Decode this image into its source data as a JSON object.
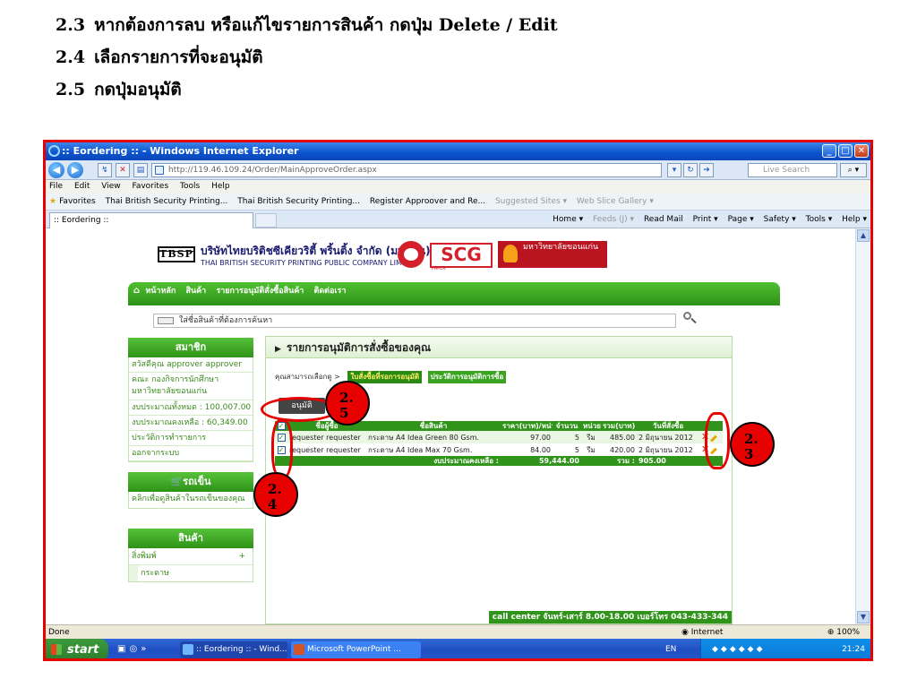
{
  "steps": [
    {
      "num": "2.3",
      "text": "หากต้องการลบ หรือแก้ไขรายการสินค้า กดปุ่ม Delete / Edit"
    },
    {
      "num": "2.4",
      "text": "เลือกรายการที่จะอนุมัติ"
    },
    {
      "num": "2.5",
      "text": "กดปุ่มอนุมัติ"
    }
  ],
  "browser": {
    "title": ":: Eordering :: - Windows Internet Explorer",
    "url": "http://119.46.109.24/Order/MainApproveOrder.aspx",
    "search_placeholder": "Live Search",
    "menu": [
      "File",
      "Edit",
      "View",
      "Favorites",
      "Tools",
      "Help"
    ],
    "favorites_label": "Favorites",
    "favorites": [
      "Thai British Security Printing...",
      "Thai British Security Printing...",
      "Register Approover and Re...",
      "Suggested Sites ▾",
      "Web Slice Gallery ▾"
    ],
    "tab_label": ":: Eordering ::",
    "commands": [
      "Home ▾",
      "Feeds (J) ▾",
      "Read Mail",
      "Print ▾",
      "Page ▾",
      "Safety ▾",
      "Tools ▾",
      "Help ▾"
    ],
    "status": "Done",
    "zone": "Internet",
    "zoom": "100%"
  },
  "site": {
    "logo_short": "TBSP",
    "company_th": "บริษัทไทยบริติชซีเคียวริตี้ พริ้นติ้ง จำกัด (มหาชน)",
    "company_en": "THAI BRITISH SECURITY PRINTING PUBLIC COMPANY LIMITED",
    "scg": "SCG",
    "scg_sub": "PAPER",
    "univ": "มหาวิทยาลัยขอนแก่น",
    "nav": [
      "หน้าหลัก",
      "สินค้า",
      "รายการอนุมัติสั่งซื้อสินค้า",
      "ติดต่อเรา"
    ],
    "search_placeholder": "ใส่ชื่อสินค้าที่ต้องการค้นหา"
  },
  "sidebar": {
    "members_title": "สมาชิก",
    "members": [
      "สวัสดีคุณ approver approver",
      "คณะ กองกิจการนักศึกษา มหาวิทยาลัยขอนแก่น",
      "งบประมาณทั้งหมด : 100,007.00",
      "งบประมาณคงเหลือ : 60,349.00",
      "ประวัติการทำรายการ",
      "ออกจากระบบ"
    ],
    "cart_title": "รถเข็น",
    "cart_link": "คลิกเพื่อดูสินค้าในรถเข็นของคุณ",
    "products_title": "สินค้า",
    "products_row": "สิ่งพิมพ์",
    "products_plus": "+",
    "products_sub": "กระดาษ"
  },
  "main": {
    "title": "รายการอนุมัติการสั่งซื้อของคุณ",
    "crumb_label": "คุณสามารถเลือกดู >",
    "tab_pending": "ใบสั่งซื้อที่รอการอนุมัติ",
    "tab_history": "ประวัติการอนุมัติการซื้อ",
    "approve_button": "อนุมัติ",
    "columns": [
      "",
      "ชื่อผู้ซื้อ",
      "ชื่อสินค้า",
      "ราคา(บาท)/หน่วย",
      "จำนวน",
      "หน่วย",
      "รวม(บาท)",
      "วันที่สั่งซื้อ",
      ""
    ],
    "rows": [
      {
        "checked": "✓",
        "buyer": "requester requester",
        "product": "กระดาษ A4 Idea Green 80 Gsm.",
        "price": "97.00",
        "qty": "5",
        "unit": "รีม",
        "total": "485.00",
        "date": "2 มิถุนายน 2012"
      },
      {
        "checked": "✓",
        "buyer": "requester requester",
        "product": "กระดาษ A4 Idea Max 70 Gsm.",
        "price": "84.00",
        "qty": "5",
        "unit": "รีม",
        "total": "420.00",
        "date": "2 มิถุนายน 2012"
      }
    ],
    "header_check": "✓",
    "budget_label": "งบประมาณคงเหลือ :",
    "budget_value": "59,444.00",
    "sum_label": "รวม :",
    "sum_value": "905.00",
    "callcenter": "call center จันทร์-เสาร์ 8.00-18.00 เบอร์โทร 043-433-344"
  },
  "taskbar": {
    "start": "start",
    "tasks": [
      ":: Eordering :: - Wind...",
      "Microsoft PowerPoint ..."
    ],
    "lang": "EN",
    "clock": "21:24"
  },
  "annotations": {
    "badge_23": "2.\n3",
    "badge_24": "2.\n4",
    "badge_25": "2.\n5"
  },
  "colors": {
    "annotation_red": "#e60000",
    "site_green": "#2f9419",
    "xp_blue": "#0a52cc"
  }
}
